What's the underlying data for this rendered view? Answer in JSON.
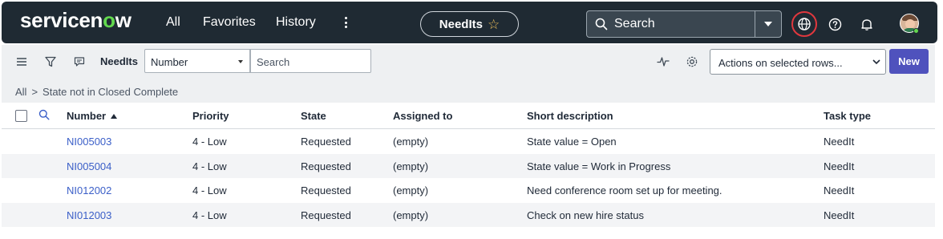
{
  "app": {
    "logo": "servicenow",
    "nav": [
      "All",
      "Favorites",
      "History"
    ],
    "pill_label": "NeedIts",
    "search_placeholder": "Search"
  },
  "toolbar": {
    "title": "NeedIts",
    "field_select": "Number",
    "search_placeholder": "Search",
    "actions_select": "Actions on selected rows...",
    "new_label": "New"
  },
  "breadcrumb": {
    "root": "All",
    "separator": ">",
    "filter": "State not in Closed Complete"
  },
  "table": {
    "columns": [
      "Number",
      "Priority",
      "State",
      "Assigned to",
      "Short description",
      "Task type"
    ],
    "rows": [
      {
        "number": "NI005003",
        "priority": "4 - Low",
        "state": "Requested",
        "assigned": "(empty)",
        "desc": "State value = Open",
        "type": "NeedIt"
      },
      {
        "number": "NI005004",
        "priority": "4 - Low",
        "state": "Requested",
        "assigned": "(empty)",
        "desc": "State value = Work in Progress",
        "type": "NeedIt"
      },
      {
        "number": "NI012002",
        "priority": "4 - Low",
        "state": "Requested",
        "assigned": "(empty)",
        "desc": "Need conference room set up for meeting.",
        "type": "NeedIt"
      },
      {
        "number": "NI012003",
        "priority": "4 - Low",
        "state": "Requested",
        "assigned": "(empty)",
        "desc": "Check on new hire status",
        "type": "NeedIt"
      }
    ]
  },
  "colors": {
    "nav_bg": "#1f2a33",
    "accent_green": "#62d84e",
    "link": "#3b5fc8",
    "primary_button": "#4f52bd",
    "globe_highlight": "#e0383e"
  },
  "icons": [
    "menu-icon",
    "filter-icon",
    "comment-icon",
    "star-icon",
    "search-icon",
    "globe-icon",
    "help-icon",
    "bell-icon",
    "activity-icon",
    "gear-icon"
  ]
}
